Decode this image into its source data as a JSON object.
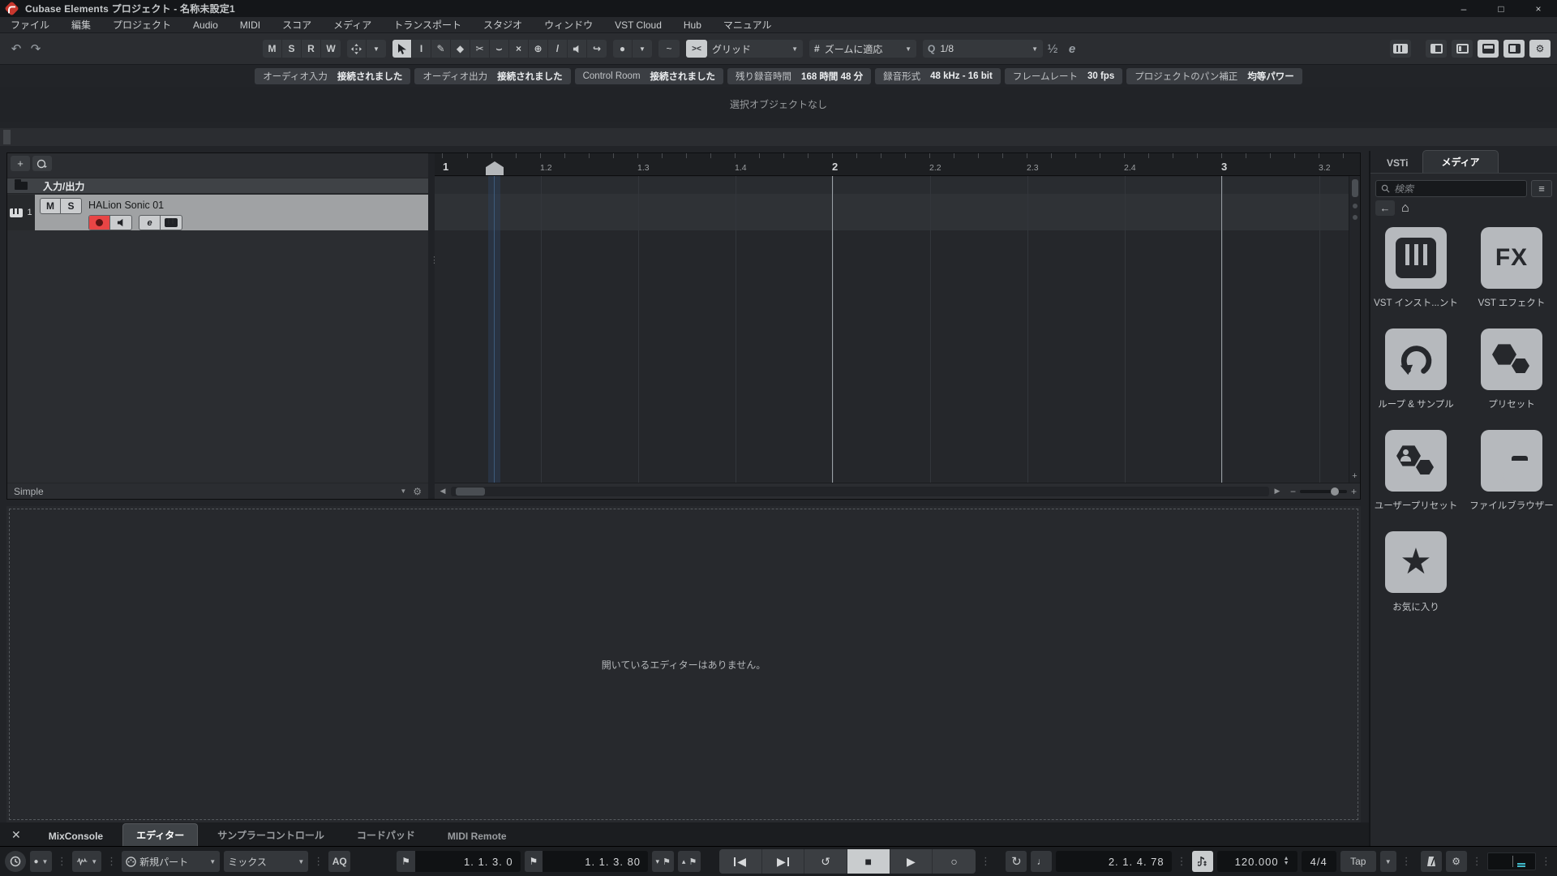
{
  "window": {
    "title": "Cubase Elements プロジェクト - 名称未設定1",
    "minimize": "–",
    "maximize": "□",
    "close": "×"
  },
  "menu": [
    "ファイル",
    "編集",
    "プロジェクト",
    "Audio",
    "MIDI",
    "スコア",
    "メディア",
    "トランスポート",
    "スタジオ",
    "ウィンドウ",
    "VST Cloud",
    "Hub",
    "マニュアル"
  ],
  "toolbar": {
    "mute": "M",
    "solo": "S",
    "read": "R",
    "write": "W",
    "grid_mode": "グリッド",
    "zoom_mode": "ズームに適応",
    "quantize": "1/8",
    "swing": "½",
    "edit": "e",
    "q": "Q",
    "snap": "><"
  },
  "infoline": [
    {
      "label": "オーディオ入力",
      "value": "接続されました"
    },
    {
      "label": "オーディオ出力",
      "value": "接続されました"
    },
    {
      "label": "Control Room",
      "value": "接続されました"
    },
    {
      "label": "残り録音時間",
      "value": "168 時間 48 分"
    },
    {
      "label": "録音形式",
      "value": "48 kHz - 16 bit"
    },
    {
      "label": "フレームレート",
      "value": "30 fps"
    },
    {
      "label": "プロジェクトのパン補正",
      "value": "均等パワー"
    }
  ],
  "status_text": "選択オブジェクトなし",
  "track_area": {
    "folder_label": "入力/出力",
    "track_number": "1",
    "track_name": "HALion Sonic 01",
    "mute": "M",
    "solo": "S",
    "edit": "e",
    "agent": "Simple"
  },
  "ruler_ticks": [
    "1",
    "1.2",
    "1.3",
    "1.4",
    "2",
    "2.2",
    "2.3",
    "2.4",
    "3",
    "3.2"
  ],
  "right_zone": {
    "tab_vsti": "VSTi",
    "tab_media": "メディア",
    "search_placeholder": "検索",
    "tiles": [
      "VST インスト...ント",
      "VST エフェクト",
      "ループ & サンプル",
      "プリセット",
      "ユーザープリセット",
      "ファイルブラウザー",
      "お気に入り"
    ]
  },
  "lower_zone": {
    "message": "開いているエディターはありません。",
    "tabs": [
      "MixConsole",
      "エディター",
      "サンプラーコントロール",
      "コードパッド",
      "MIDI Remote"
    ]
  },
  "transport": {
    "midi_record_mode": "新規パート",
    "audio_record_mode": "ミックス",
    "aq": "AQ",
    "left_locator": "1. 1. 3. 0",
    "right_locator": "1. 1. 3. 80",
    "time": "2. 1. 4. 78",
    "tempo": "120.000",
    "signature": "4/4",
    "tap": "Tap"
  },
  "icons": {
    "undo": "↶",
    "redo": "↷",
    "dropdown": "▼",
    "dots": "⋮",
    "plus": "+",
    "range": "I",
    "pencil": "✎",
    "eraser": "◆",
    "scissors": "✂",
    "glue": "⌣",
    "mute_x": "×",
    "zoom_plus": "⊕",
    "line": "/",
    "scrub": "↪",
    "color_dot": "●",
    "automation": "~",
    "back": "←",
    "home": "⌂",
    "list": "≡",
    "flag": "⚑",
    "note": "♩",
    "stop": "■",
    "play": "▶",
    "record": "○",
    "loop": "↺",
    "jump": "↻",
    "prev": "◀",
    "next": "▶",
    "star": "★",
    "up": "▲",
    "down": "▼",
    "gear": "⚙",
    "minus": "−",
    "close_x": "✕",
    "tri_down": "▾",
    "tri_up": "▴"
  }
}
